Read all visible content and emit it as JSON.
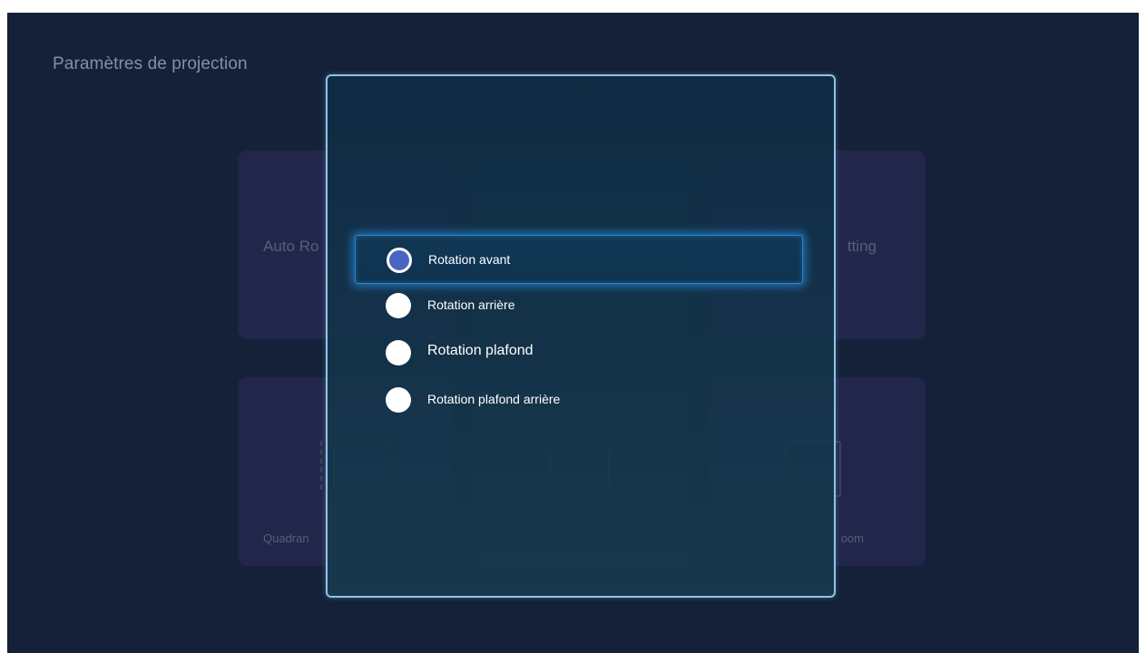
{
  "page": {
    "title": "Paramètres de projection"
  },
  "background_cards": [
    {
      "label": "Auto Ro"
    },
    {
      "label": ""
    },
    {
      "label": "tting"
    },
    {
      "label": "Quadran",
      "icon": "keystone-icon"
    },
    {
      "label": "",
      "icon": "screen-icon"
    },
    {
      "label": "oom",
      "icon": "zoom-icon"
    }
  ],
  "dialog": {
    "options": [
      {
        "label": "Rotation avant",
        "selected": true
      },
      {
        "label": "Rotation arrière",
        "selected": false
      },
      {
        "label": "Rotation plafond",
        "selected": false
      },
      {
        "label": "Rotation plafond arrière",
        "selected": false
      }
    ]
  },
  "colors": {
    "background": "#15223a",
    "card": "#2a2a57",
    "modal_border": "#8fc3e4",
    "selection_glow": "#2486d6",
    "radio_selected": "#4a64c2"
  }
}
